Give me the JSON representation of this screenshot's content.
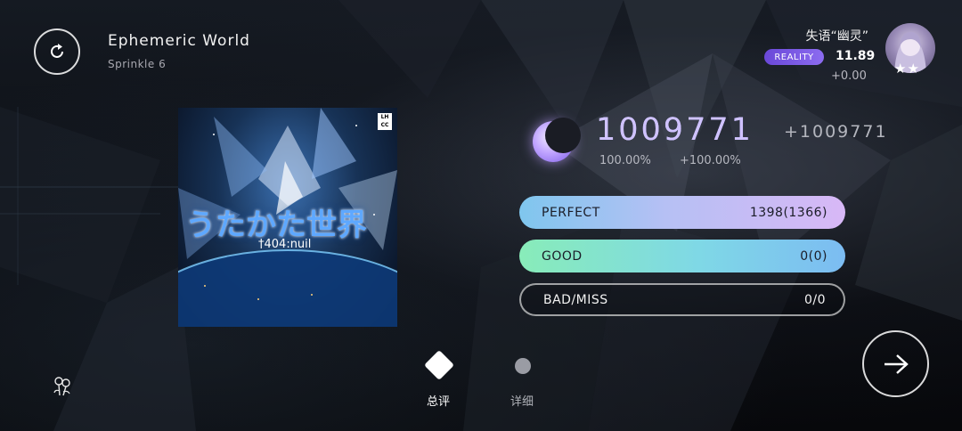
{
  "song": {
    "title": "Ephemeric World",
    "difficulty": "Sprinkle 6"
  },
  "player": {
    "name": "失语“幽灵”",
    "badge": "REALITY",
    "rks": "11.89",
    "rks_delta": "+0.00",
    "stars": "★★"
  },
  "cover": {
    "title": "うたかた世界",
    "artist": "†404:nuil",
    "logo": "LHCC"
  },
  "score": {
    "value": "1009771",
    "delta": "+1009771",
    "accuracy": "100.00%",
    "accuracy_delta": "+100.00%"
  },
  "judgements": [
    {
      "label": "PERFECT",
      "value": "1398(1366)"
    },
    {
      "label": "GOOD",
      "value": "0(0)"
    },
    {
      "label": "BAD/MISS",
      "value": "0/0"
    }
  ],
  "tabs": [
    {
      "label": "总评",
      "selected": true
    },
    {
      "label": "详细",
      "selected": false
    }
  ],
  "icons": {
    "retry": "retry-icon",
    "next": "arrow-right-icon",
    "moon": "moon-icon",
    "flower": "flower-icon"
  },
  "colors": {
    "perfect_gradient": [
      "#7fc6ee",
      "#d8b8f6"
    ],
    "good_gradient": [
      "#88ecb9",
      "#7cbcf2"
    ],
    "badge": "#7a5ae6",
    "score": "#cfc2ff"
  }
}
